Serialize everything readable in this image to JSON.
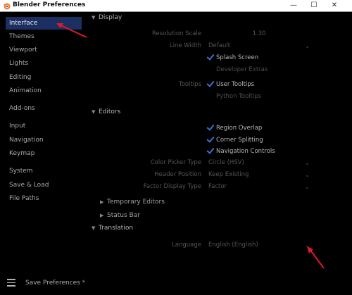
{
  "window": {
    "title": "Blender Preferences",
    "controls": {
      "minimize": "—",
      "maximize": "☐",
      "close": "✕"
    }
  },
  "sidebar": {
    "items": [
      {
        "label": "Interface",
        "active": true
      },
      {
        "label": "Themes"
      },
      {
        "label": "Viewport"
      },
      {
        "label": "Lights"
      },
      {
        "label": "Editing"
      },
      {
        "label": "Animation"
      },
      {
        "label": "Add-ons"
      },
      {
        "label": "Input"
      },
      {
        "label": "Navigation"
      },
      {
        "label": "Keymap"
      },
      {
        "label": "System"
      },
      {
        "label": "Save & Load"
      },
      {
        "label": "File Paths"
      }
    ],
    "save_preferences": "Save Preferences *"
  },
  "display": {
    "header": "Display",
    "resolution_scale": {
      "label": "Resolution Scale",
      "value": "1.30"
    },
    "line_width": {
      "label": "Line Width",
      "value": "Default"
    },
    "splash_screen": {
      "label": "Splash Screen",
      "checked": true
    },
    "developer_extras": {
      "label": "Developer Extras",
      "checked": false
    },
    "tooltips_label": "Tooltips",
    "user_tooltips": {
      "label": "User Tooltips",
      "checked": true
    },
    "python_tooltips": {
      "label": "Python Tooltips",
      "checked": false
    }
  },
  "editors": {
    "header": "Editors",
    "region_overlap": {
      "label": "Region Overlap",
      "checked": true
    },
    "corner_splitting": {
      "label": "Corner Splitting",
      "checked": true
    },
    "navigation_controls": {
      "label": "Navigation Controls",
      "checked": true
    },
    "color_picker_type": {
      "label": "Color Picker Type",
      "value": "Circle (HSV)"
    },
    "header_position": {
      "label": "Header Position",
      "value": "Keep Existing"
    },
    "factor_display_type": {
      "label": "Factor Display Type",
      "value": "Factor"
    },
    "temporary_editors": "Temporary Editors",
    "status_bar": "Status Bar"
  },
  "translation": {
    "header": "Translation",
    "language": {
      "label": "Language",
      "value": "English (English)"
    }
  },
  "colors": {
    "accent": "#1c2f63",
    "check": "#3d6fd8",
    "annotation": "#e0192b"
  }
}
